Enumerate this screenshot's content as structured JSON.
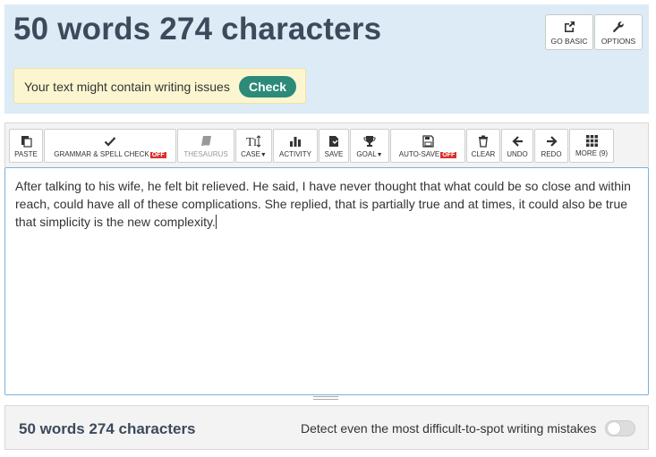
{
  "header": {
    "title": "50 words 274 characters",
    "go_basic_label": "GO BASIC",
    "options_label": "OPTIONS",
    "issues_text": "Your text might contain writing issues",
    "check_label": "Check"
  },
  "toolbar": {
    "paste": "PASTE",
    "grammar": "GRAMMAR & SPELL CHECK",
    "grammar_state": "OFF",
    "thesaurus": "THESAURUS",
    "case": "CASE",
    "activity": "ACTIVITY",
    "save": "SAVE",
    "goal": "GOAL",
    "autosave": "AUTO-SAVE",
    "autosave_state": "OFF",
    "clear": "CLEAR",
    "undo": "UNDO",
    "redo": "REDO",
    "more": "MORE (9)"
  },
  "editor": {
    "text": "After talking to his wife, he felt bit relieved. He said, I have never thought that what could be so close and within reach, could have all of these complications. She replied, that is partially true and at times, it could also be true that simplicity is the new complexity."
  },
  "footer": {
    "count": "50 words 274 characters",
    "detect_text": "Detect even the most difficult-to-spot writing mistakes",
    "toggle_on": false
  },
  "colors": {
    "header_bg": "#dcebf5",
    "check_button": "#2b8a78",
    "off_badge": "#d9302c",
    "title_text": "#3d4a5b"
  }
}
